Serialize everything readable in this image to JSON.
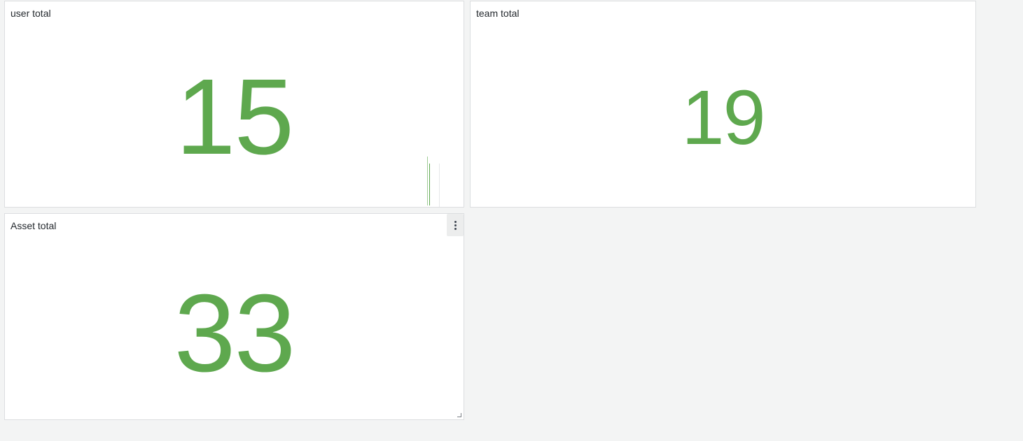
{
  "panels": {
    "user": {
      "title": "user total",
      "value": "15"
    },
    "team": {
      "title": "team total",
      "value": "19"
    },
    "asset": {
      "title": "Asset total",
      "value": "33",
      "menu_icon": "kebab-menu-icon"
    }
  },
  "colors": {
    "value": "#5ea84e",
    "background": "#f3f4f4",
    "panel": "#ffffff"
  }
}
